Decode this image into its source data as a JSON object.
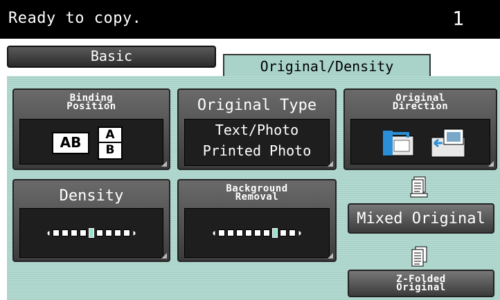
{
  "status": {
    "message": "Ready to copy.",
    "copy_count": "1"
  },
  "tabs": [
    {
      "label": "Basic",
      "selected": false
    },
    {
      "label": "Original/Density",
      "selected": true
    }
  ],
  "buttons": {
    "binding_position": {
      "label_line1": "Binding",
      "label_line2": "Position",
      "icon_text_1": "AB",
      "icon_text_2a": "A",
      "icon_text_2b": "B"
    },
    "original_type": {
      "label": "Original Type",
      "value_line1": "Text/Photo",
      "value_line2": "Printed Photo"
    },
    "original_direction": {
      "label_line1": "Original",
      "label_line2": "Direction"
    },
    "density": {
      "label": "Density",
      "level_index": 5,
      "levels": 9
    },
    "background_removal": {
      "label_line1": "Background",
      "label_line2": "Removal",
      "level_index": 7,
      "levels": 9
    },
    "mixed_original": {
      "label": "Mixed Original"
    },
    "z_folded_original": {
      "label_line1": "Z-Folded",
      "label_line2": "Original"
    }
  },
  "colors": {
    "panel": "#a9d3c9",
    "topbar": "#000000",
    "button": "#4a4a4a",
    "marker": "#9ce0cf"
  }
}
